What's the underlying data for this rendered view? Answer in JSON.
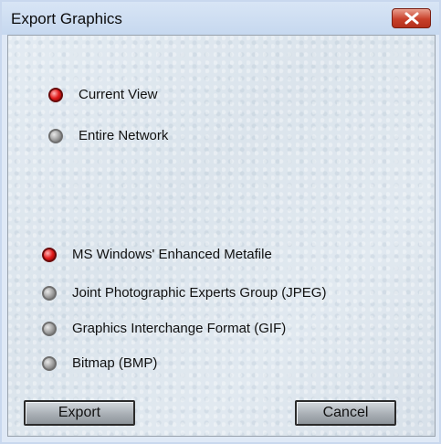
{
  "window": {
    "title": "Export Graphics"
  },
  "extent_group": {
    "options": [
      {
        "label": "Current View",
        "selected": true
      },
      {
        "label": "Entire Network",
        "selected": false
      }
    ]
  },
  "format_group": {
    "options": [
      {
        "label": "MS Windows' Enhanced Metafile",
        "selected": true
      },
      {
        "label": "Joint Photographic Experts Group (JPEG)",
        "selected": false
      },
      {
        "label": "Graphics Interchange Format (GIF)",
        "selected": false
      },
      {
        "label": "Bitmap (BMP)",
        "selected": false
      }
    ]
  },
  "buttons": {
    "export": "Export",
    "cancel": "Cancel"
  },
  "colors": {
    "selected_radio": "#e11b1b",
    "close_button": "#c8402a"
  }
}
